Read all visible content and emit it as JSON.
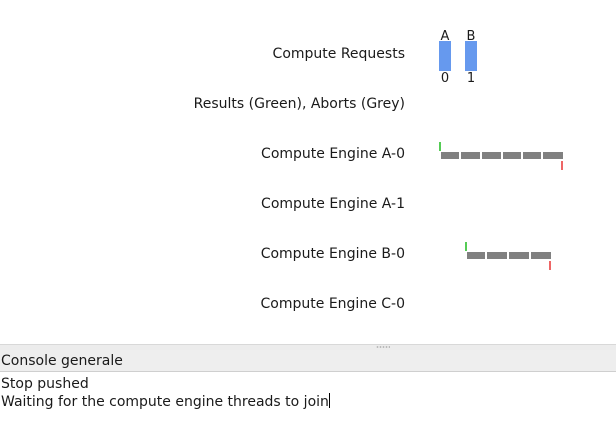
{
  "rows": {
    "compute_requests": "Compute Requests",
    "results_aborts": "Results (Green), Aborts (Grey)",
    "engine_a0": "Compute Engine A-0",
    "engine_a1": "Compute Engine A-1",
    "engine_b0": "Compute Engine B-0",
    "engine_c0": "Compute Engine C-0"
  },
  "requests": [
    {
      "name": "A",
      "count": "0"
    },
    {
      "name": "B",
      "count": "1"
    }
  ],
  "colors": {
    "request_bar": "#6699ee",
    "result": "#55cc55",
    "abort": "#808080",
    "end_marker": "#ee6666"
  },
  "console": {
    "title": "Console generale",
    "lines": [
      "Stop pushed",
      "Waiting for the compute engine threads to join"
    ]
  }
}
